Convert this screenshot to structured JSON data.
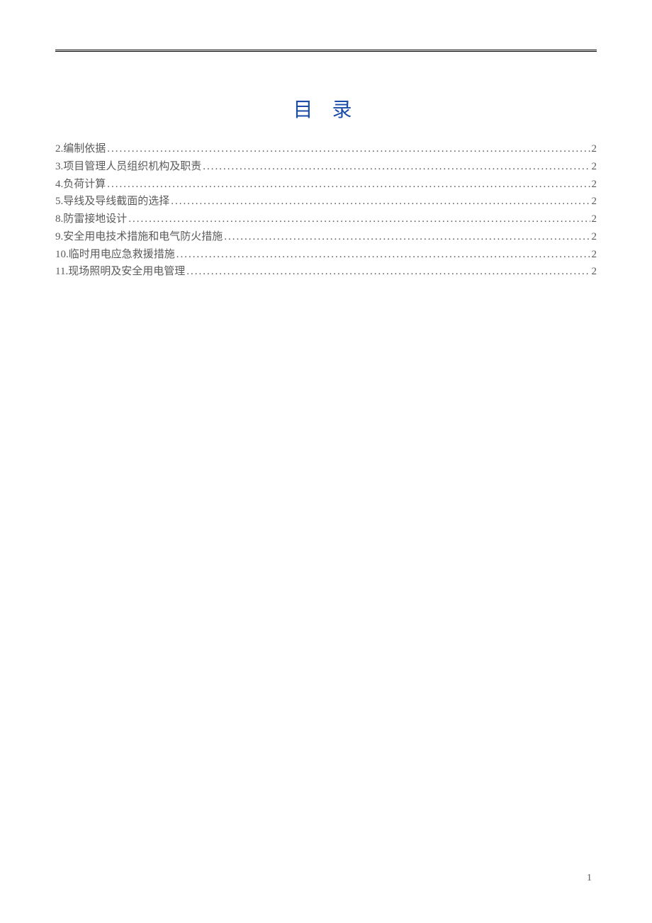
{
  "title": "目 录",
  "toc": [
    {
      "label": "2.编制依据",
      "page": "2"
    },
    {
      "label": "3.项目管理人员组织机构及职责",
      "page": "2"
    },
    {
      "label": "4.负荷计算",
      "page": "2"
    },
    {
      "label": "5.导线及导线截面的选择",
      "page": "2"
    },
    {
      "label": "8.防雷接地设计",
      "page": "2"
    },
    {
      "label": "9.安全用电技术措施和电气防火措施",
      "page": "2"
    },
    {
      "label": "10.临时用电应急救援措施",
      "page": "2"
    },
    {
      "label": "11.现场照明及安全用电管理",
      "page": "2"
    }
  ],
  "pageNumber": "1"
}
